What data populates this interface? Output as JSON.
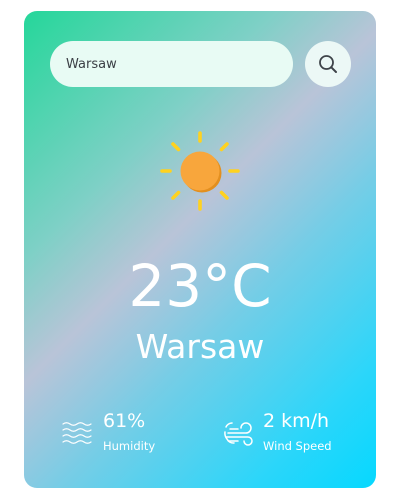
{
  "search": {
    "value": "Warsaw",
    "button_icon": "search-icon"
  },
  "weather": {
    "icon": "sun-icon",
    "temperature": "23°C",
    "city": "Warsaw"
  },
  "stats": {
    "humidity": {
      "value": "61%",
      "label": "Humidity",
      "icon": "humidity-waves-icon"
    },
    "wind": {
      "value": "2 km/h",
      "label": "Wind Speed",
      "icon": "wind-icon"
    }
  },
  "colors": {
    "gradient_start": "#25d79a",
    "gradient_mid": "#b9c4d8",
    "gradient_end": "#06d8ff",
    "search_bg": "#e8fbf4",
    "text_primary": "#ffffff",
    "sun_core": "#f7a43a",
    "sun_rays": "#ffd21f"
  }
}
